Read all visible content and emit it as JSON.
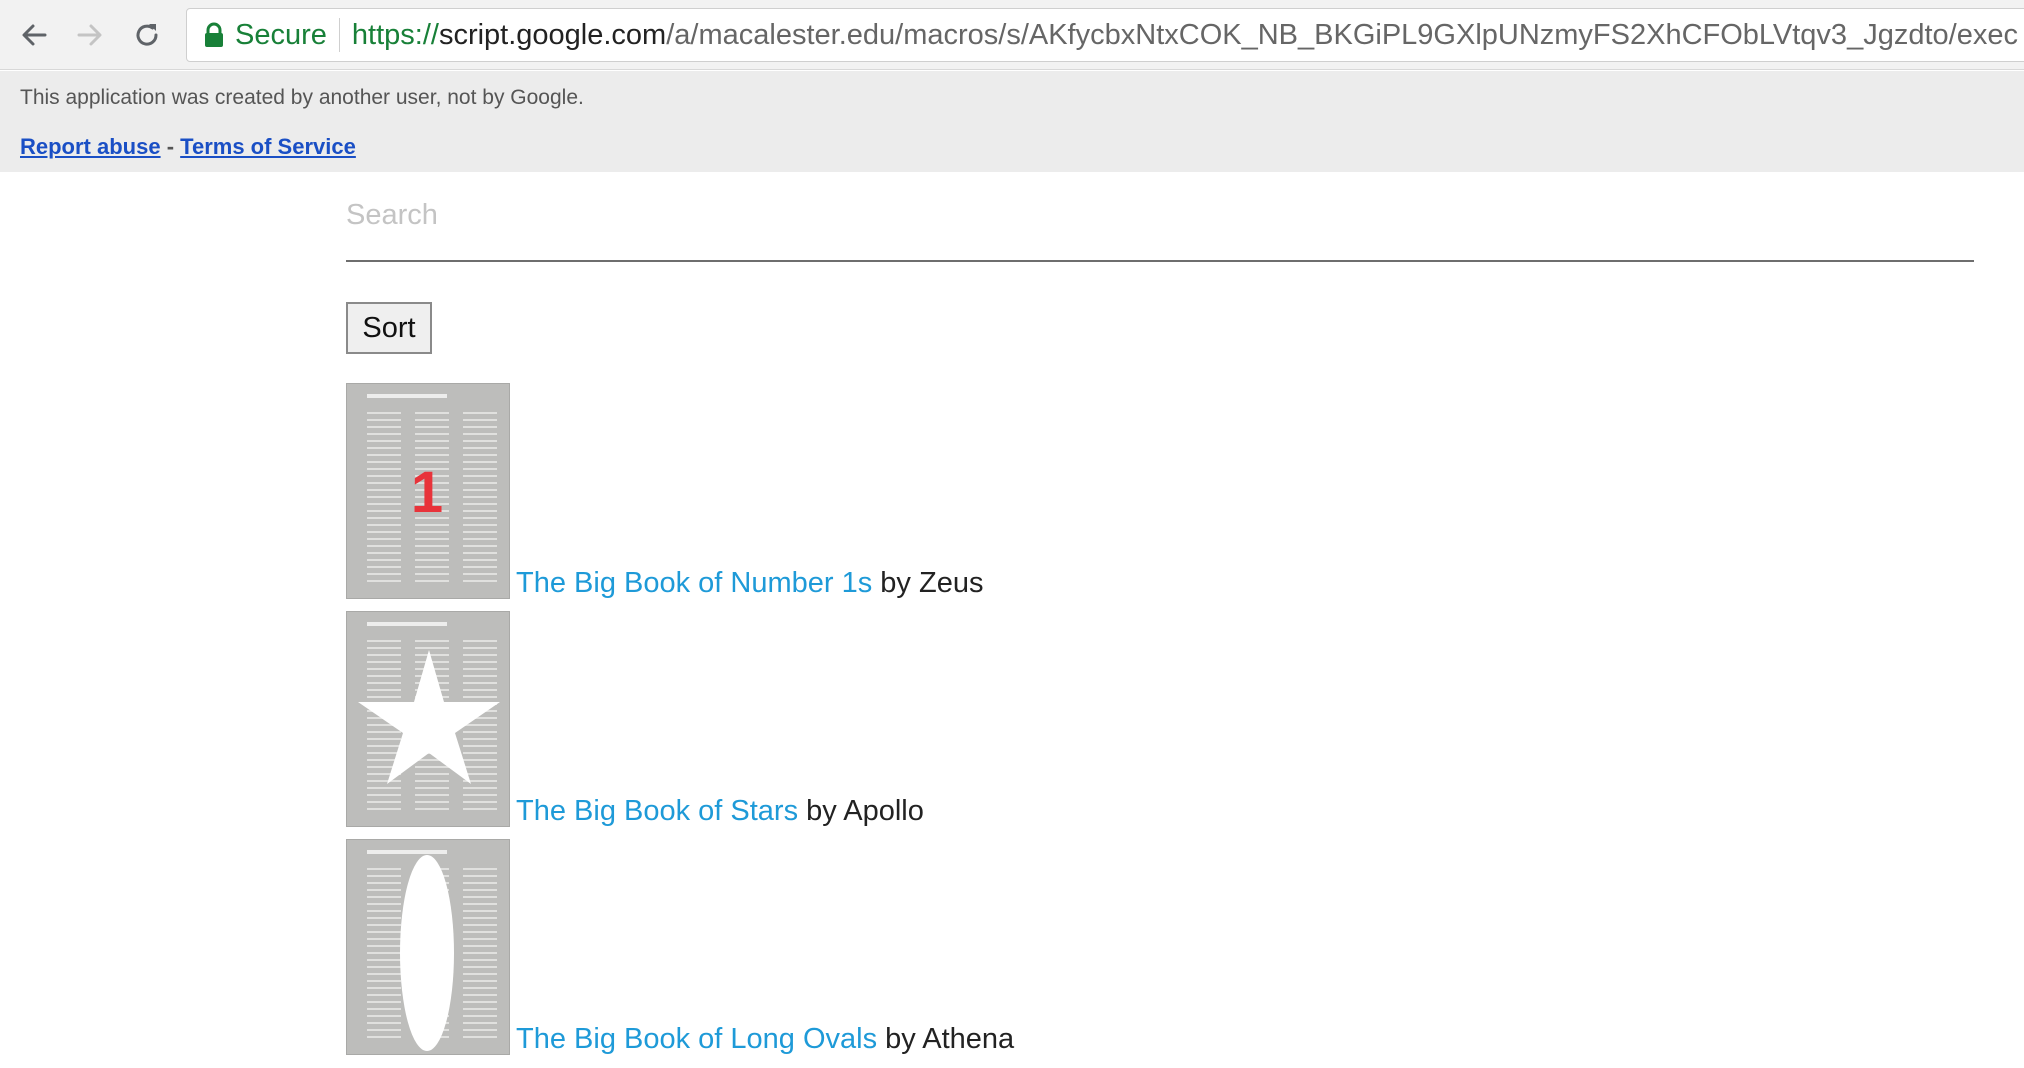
{
  "browser": {
    "secure_label": "Secure",
    "url_scheme": "https://",
    "url_host": "script.google.com",
    "url_path": "/a/macalester.edu/macros/s/AKfycbxNtxCOK_NB_BKGiPL9GXlpUNzmyFS2XhCFObLVtqv3_Jgzdto/exec"
  },
  "banner": {
    "notice": "This application was created by another user, not by Google.",
    "report_abuse": "Report abuse",
    "separator": "-",
    "terms": "Terms of Service"
  },
  "search": {
    "placeholder": "Search",
    "value": ""
  },
  "sort_label": "Sort",
  "books": [
    {
      "cover_mark": "number-one",
      "cover_text": "1",
      "title": "The Big Book of Number 1s",
      "byline": "by Zeus"
    },
    {
      "cover_mark": "star",
      "title": "The Big Book of Stars",
      "byline": "by Apollo"
    },
    {
      "cover_mark": "long-oval",
      "title": "The Big Book of Long Ovals",
      "byline": "by Athena"
    }
  ],
  "colors": {
    "link": "#1e9ad8",
    "secure": "#188038",
    "cover_number": "#e8333a"
  }
}
